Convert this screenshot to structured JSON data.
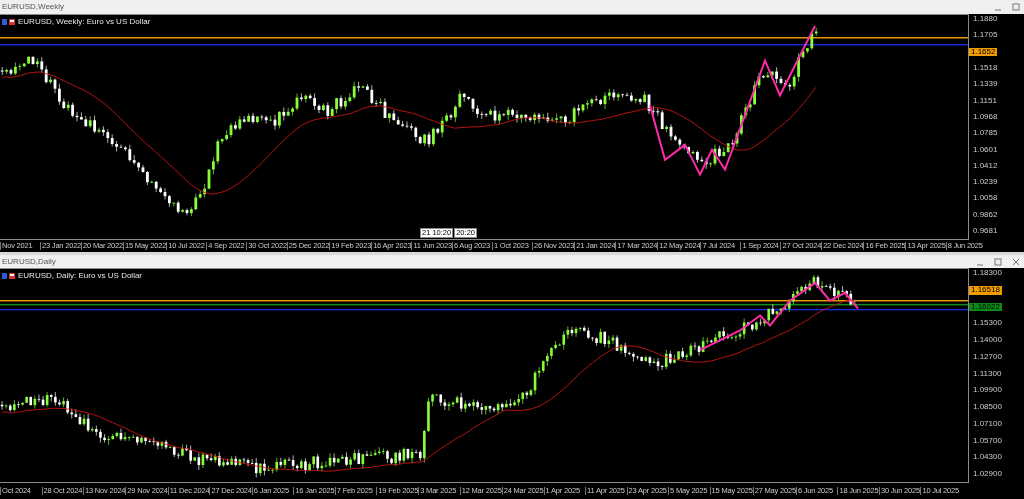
{
  "windows": [
    {
      "kind": "weekly",
      "title": "EURUSD,Weekly",
      "symbol_label": "EURUSD, Weekly:  Euro vs US Dollar",
      "axis_labels": [
        {
          "kind": "tick",
          "text": "1.1880"
        },
        {
          "kind": "tick",
          "text": "1.1705"
        },
        {
          "kind": "tag",
          "text": "1.1652",
          "color": "#f09c00"
        },
        {
          "kind": "tick",
          "text": "1.1518"
        },
        {
          "kind": "tick",
          "text": "1.1339"
        },
        {
          "kind": "tick",
          "text": "1.1151"
        },
        {
          "kind": "tick",
          "text": "1.0968"
        },
        {
          "kind": "tick",
          "text": "1.0785"
        },
        {
          "kind": "tick",
          "text": "1.0601"
        },
        {
          "kind": "tick",
          "text": "1.0412"
        },
        {
          "kind": "tick",
          "text": "1.0239"
        },
        {
          "kind": "tick",
          "text": "1.0058"
        },
        {
          "kind": "tick",
          "text": "0.9862"
        },
        {
          "kind": "tick",
          "text": "0.9681"
        }
      ],
      "price_lines": [
        {
          "color": "#e89a00"
        },
        {
          "color": "#1c2ad8"
        }
      ],
      "crosshair_tags": [
        "21 10:20",
        "20:20"
      ],
      "date_ticks": [
        "Nov 2021",
        "23 Jan 2022",
        "20 Mar 2022",
        "15 May 2022",
        "10 Jul 2022",
        "4 Sep 2022",
        "30 Oct 2022",
        "25 Dec 2022",
        "19 Feb 2023",
        "16 Apr 2023",
        "11 Jun 2023",
        "6 Aug 2023",
        "1 Oct 2023",
        "26 Nov 2023",
        "21 Jan 2024",
        "17 Mar 2024",
        "12 May 2024",
        "7 Jul 2024",
        "1 Sep 2024",
        "27 Oct 2024",
        "22 Dec 2024",
        "16 Feb 2025",
        "13 Apr 2025",
        "8 Jun 2025"
      ]
    },
    {
      "kind": "daily",
      "title": "EURUSD,Daily",
      "symbol_label": "EURUSD, Daily:  Euro vs US Dollar",
      "axis_labels": [
        {
          "kind": "tick",
          "text": "1.18300"
        },
        {
          "kind": "tag",
          "text": "1.16518",
          "color": "#f09c00"
        },
        {
          "kind": "tag",
          "text": "1.16022",
          "color": "#0c8a18"
        },
        {
          "kind": "tick",
          "text": "1.15300"
        },
        {
          "kind": "tick",
          "text": "1.14000"
        },
        {
          "kind": "tick",
          "text": "1.12700"
        },
        {
          "kind": "tick",
          "text": "1.11300"
        },
        {
          "kind": "tick",
          "text": "1.09900"
        },
        {
          "kind": "tick",
          "text": "1.08500"
        },
        {
          "kind": "tick",
          "text": "1.07100"
        },
        {
          "kind": "tick",
          "text": "1.05700"
        },
        {
          "kind": "tick",
          "text": "1.04300"
        },
        {
          "kind": "tick",
          "text": "1.02900"
        }
      ],
      "price_lines": [
        {
          "color": "#e89a00"
        },
        {
          "color": "#0f8a1c"
        },
        {
          "color": "#1c2ad8"
        }
      ],
      "date_ticks": [
        "Oct 2024",
        "28 Oct 2024",
        "13 Nov 2024",
        "29 Nov 2024",
        "11 Dec 2024",
        "27 Dec 2024",
        "6 Jan 2025",
        "16 Jan 2025",
        "7 Feb 2025",
        "19 Feb 2025",
        "3 Mar 2025",
        "12 Mar 2025",
        "24 Mar 2025",
        "1 Apr 2025",
        "11 Apr 2025",
        "23 Apr 2025",
        "5 May 2025",
        "15 May 2025",
        "27 May 2025",
        "6 Jun 2025",
        "18 Jun 2025",
        "30 Jun 2025",
        "10 Jul 2025"
      ]
    }
  ]
}
